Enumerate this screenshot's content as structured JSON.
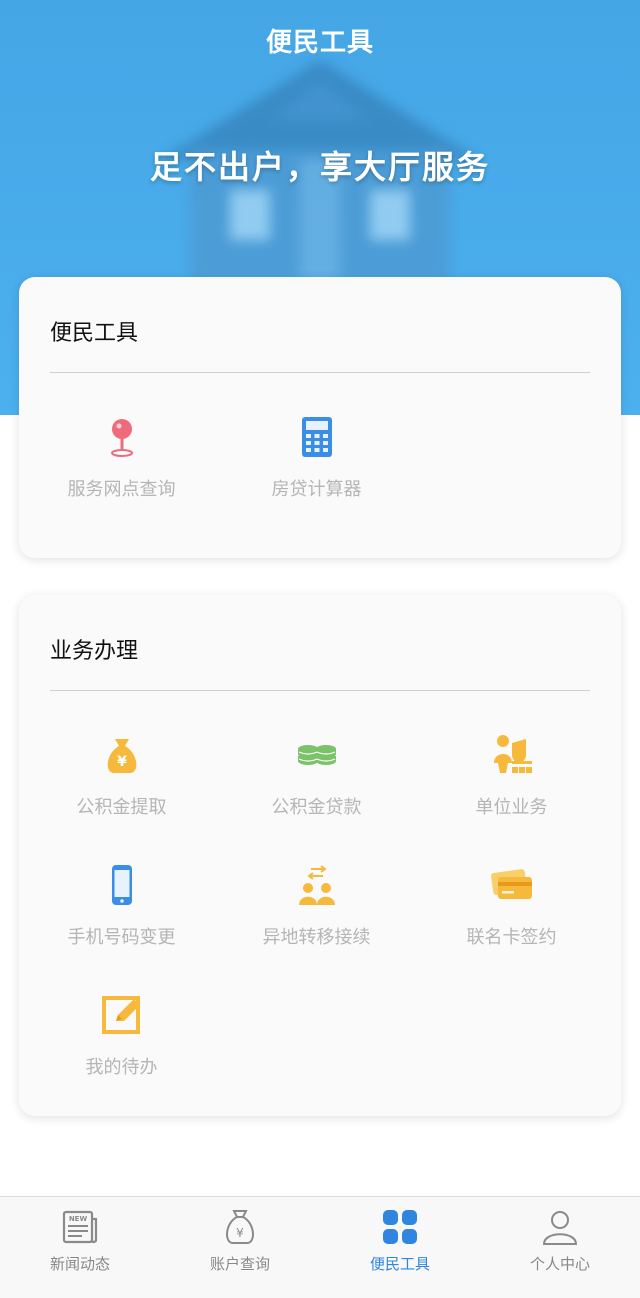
{
  "header": {
    "title": "便民工具",
    "slogan": "足不出户，享大厅服务"
  },
  "convenience": {
    "title": "便民工具",
    "items": [
      {
        "label": "服务网点查询",
        "icon": "location-pin-icon"
      },
      {
        "label": "房贷计算器",
        "icon": "calculator-icon"
      }
    ]
  },
  "business": {
    "title": "业务办理",
    "items": [
      {
        "label": "公积金提取",
        "icon": "money-bag-icon"
      },
      {
        "label": "公积金贷款",
        "icon": "coin-stack-icon"
      },
      {
        "label": "单位业务",
        "icon": "organization-icon"
      },
      {
        "label": "手机号码变更",
        "icon": "mobile-phone-icon"
      },
      {
        "label": "异地转移接续",
        "icon": "transfer-users-icon"
      },
      {
        "label": "联名卡签约",
        "icon": "bank-card-icon"
      },
      {
        "label": "我的待办",
        "icon": "edit-todo-icon"
      }
    ]
  },
  "tabbar": {
    "items": [
      {
        "label": "新闻动态",
        "icon": "news-icon"
      },
      {
        "label": "账户查询",
        "icon": "yuan-bag-icon"
      },
      {
        "label": "便民工具",
        "icon": "grid-icon",
        "active": true
      },
      {
        "label": "个人中心",
        "icon": "person-icon"
      }
    ]
  },
  "colors": {
    "accent": "#2f86e0",
    "hero": "#45a6e6",
    "icon_orange": "#f6b93b",
    "icon_green": "#7cc26a",
    "icon_red": "#ef6b7b",
    "icon_blue": "#3a8ee6"
  }
}
